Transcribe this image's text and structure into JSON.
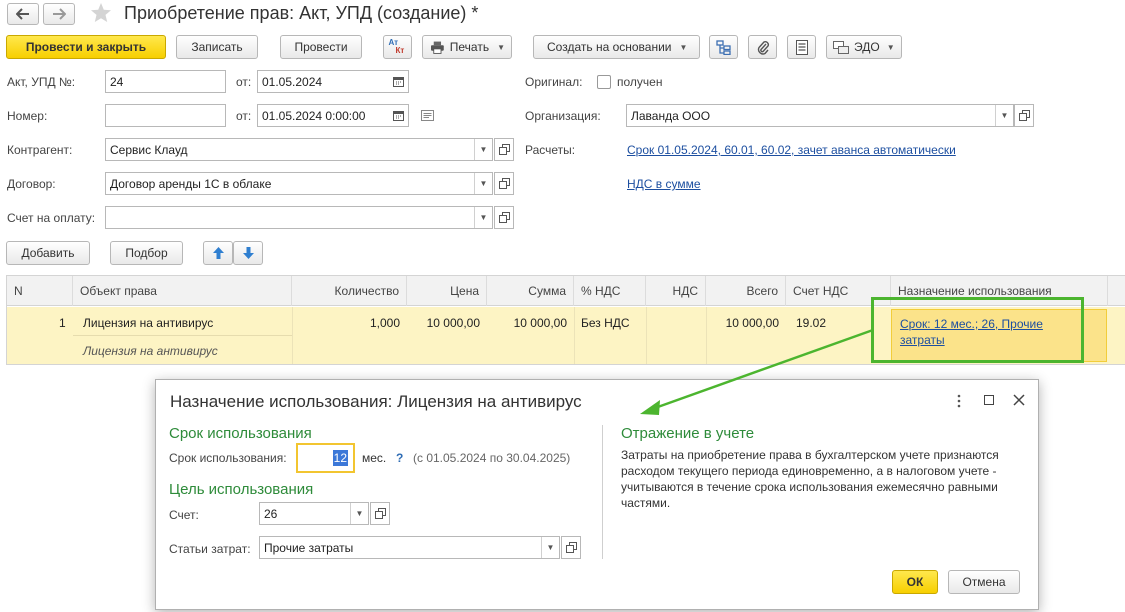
{
  "window": {
    "title": "Приобретение прав: Акт, УПД (создание) *"
  },
  "toolbar": {
    "post_close": "Провести и закрыть",
    "save": "Записать",
    "post": "Провести",
    "dtkt_top": "Ат",
    "dtkt_bottom": "Кт",
    "print": "Печать",
    "create_basis": "Создать на основании",
    "edo": "ЭДО"
  },
  "form": {
    "doc_label": "Акт, УПД №:",
    "doc_number": "24",
    "from_label": "от:",
    "doc_date": "01.05.2024",
    "number_label": "Номер:",
    "number_value": "",
    "from_label2": "от:",
    "number_date": "01.05.2024  0:00:00",
    "original_label": "Оригинал:",
    "original_received": "получен",
    "org_label": "Организация:",
    "org_value": "Лаванда ООО",
    "counterparty_label": "Контрагент:",
    "counterparty_value": "Сервис Клауд",
    "calc_label": "Расчеты:",
    "calc_link": "Срок 01.05.2024, 60.01, 60.02, зачет аванса автоматически",
    "contract_label": "Договор:",
    "contract_value": "Договор аренды 1С в облаке",
    "vat_link": "НДС в сумме",
    "invoice_label": "Счет на оплату:",
    "invoice_value": ""
  },
  "table_toolbar": {
    "add": "Добавить",
    "pick": "Подбор"
  },
  "table": {
    "columns": [
      "N",
      "Объект права",
      "Количество",
      "Цена",
      "Сумма",
      "% НДС",
      "НДС",
      "Всего",
      "Счет НДС",
      "Назначение использования"
    ],
    "rows": [
      {
        "n": "1",
        "object": "Лицензия на антивирус",
        "object_sub": "Лицензия на антивирус",
        "qty": "1,000",
        "price": "10 000,00",
        "sum": "10 000,00",
        "vat_rate": "Без НДС",
        "vat": "",
        "total": "10 000,00",
        "vat_account": "19.02",
        "purpose_line1": "Срок: 12 мес.; 26, Прочие",
        "purpose_line2": "затраты"
      }
    ]
  },
  "dialog": {
    "title": "Назначение использования: Лицензия на антивирус",
    "section_term": "Срок использования",
    "term_label": "Срок использования:",
    "term_value": "12",
    "term_unit": "мес.",
    "term_help": "?",
    "term_period": "(с 01.05.2024 по 30.04.2025)",
    "section_goal": "Цель использования",
    "account_label": "Счет:",
    "account_value": "26",
    "cost_label": "Статьи затрат:",
    "cost_value": "Прочие затраты",
    "section_reflect": "Отражение в учете",
    "reflect_text": "Затраты на приобретение права в бухгалтерском учете признаются расходом текущего периода единовременно, а в налоговом учете - учитываются в течение срока использования ежемесячно равными частями.",
    "ok": "ОК",
    "cancel": "Отмена"
  },
  "colors": {
    "accent_yellow": "#f7cf00",
    "section_green": "#2e8b3a",
    "link_blue": "#1d4fa0",
    "highlight_green": "#4cb52f",
    "row_selected": "#fdf4c4"
  }
}
